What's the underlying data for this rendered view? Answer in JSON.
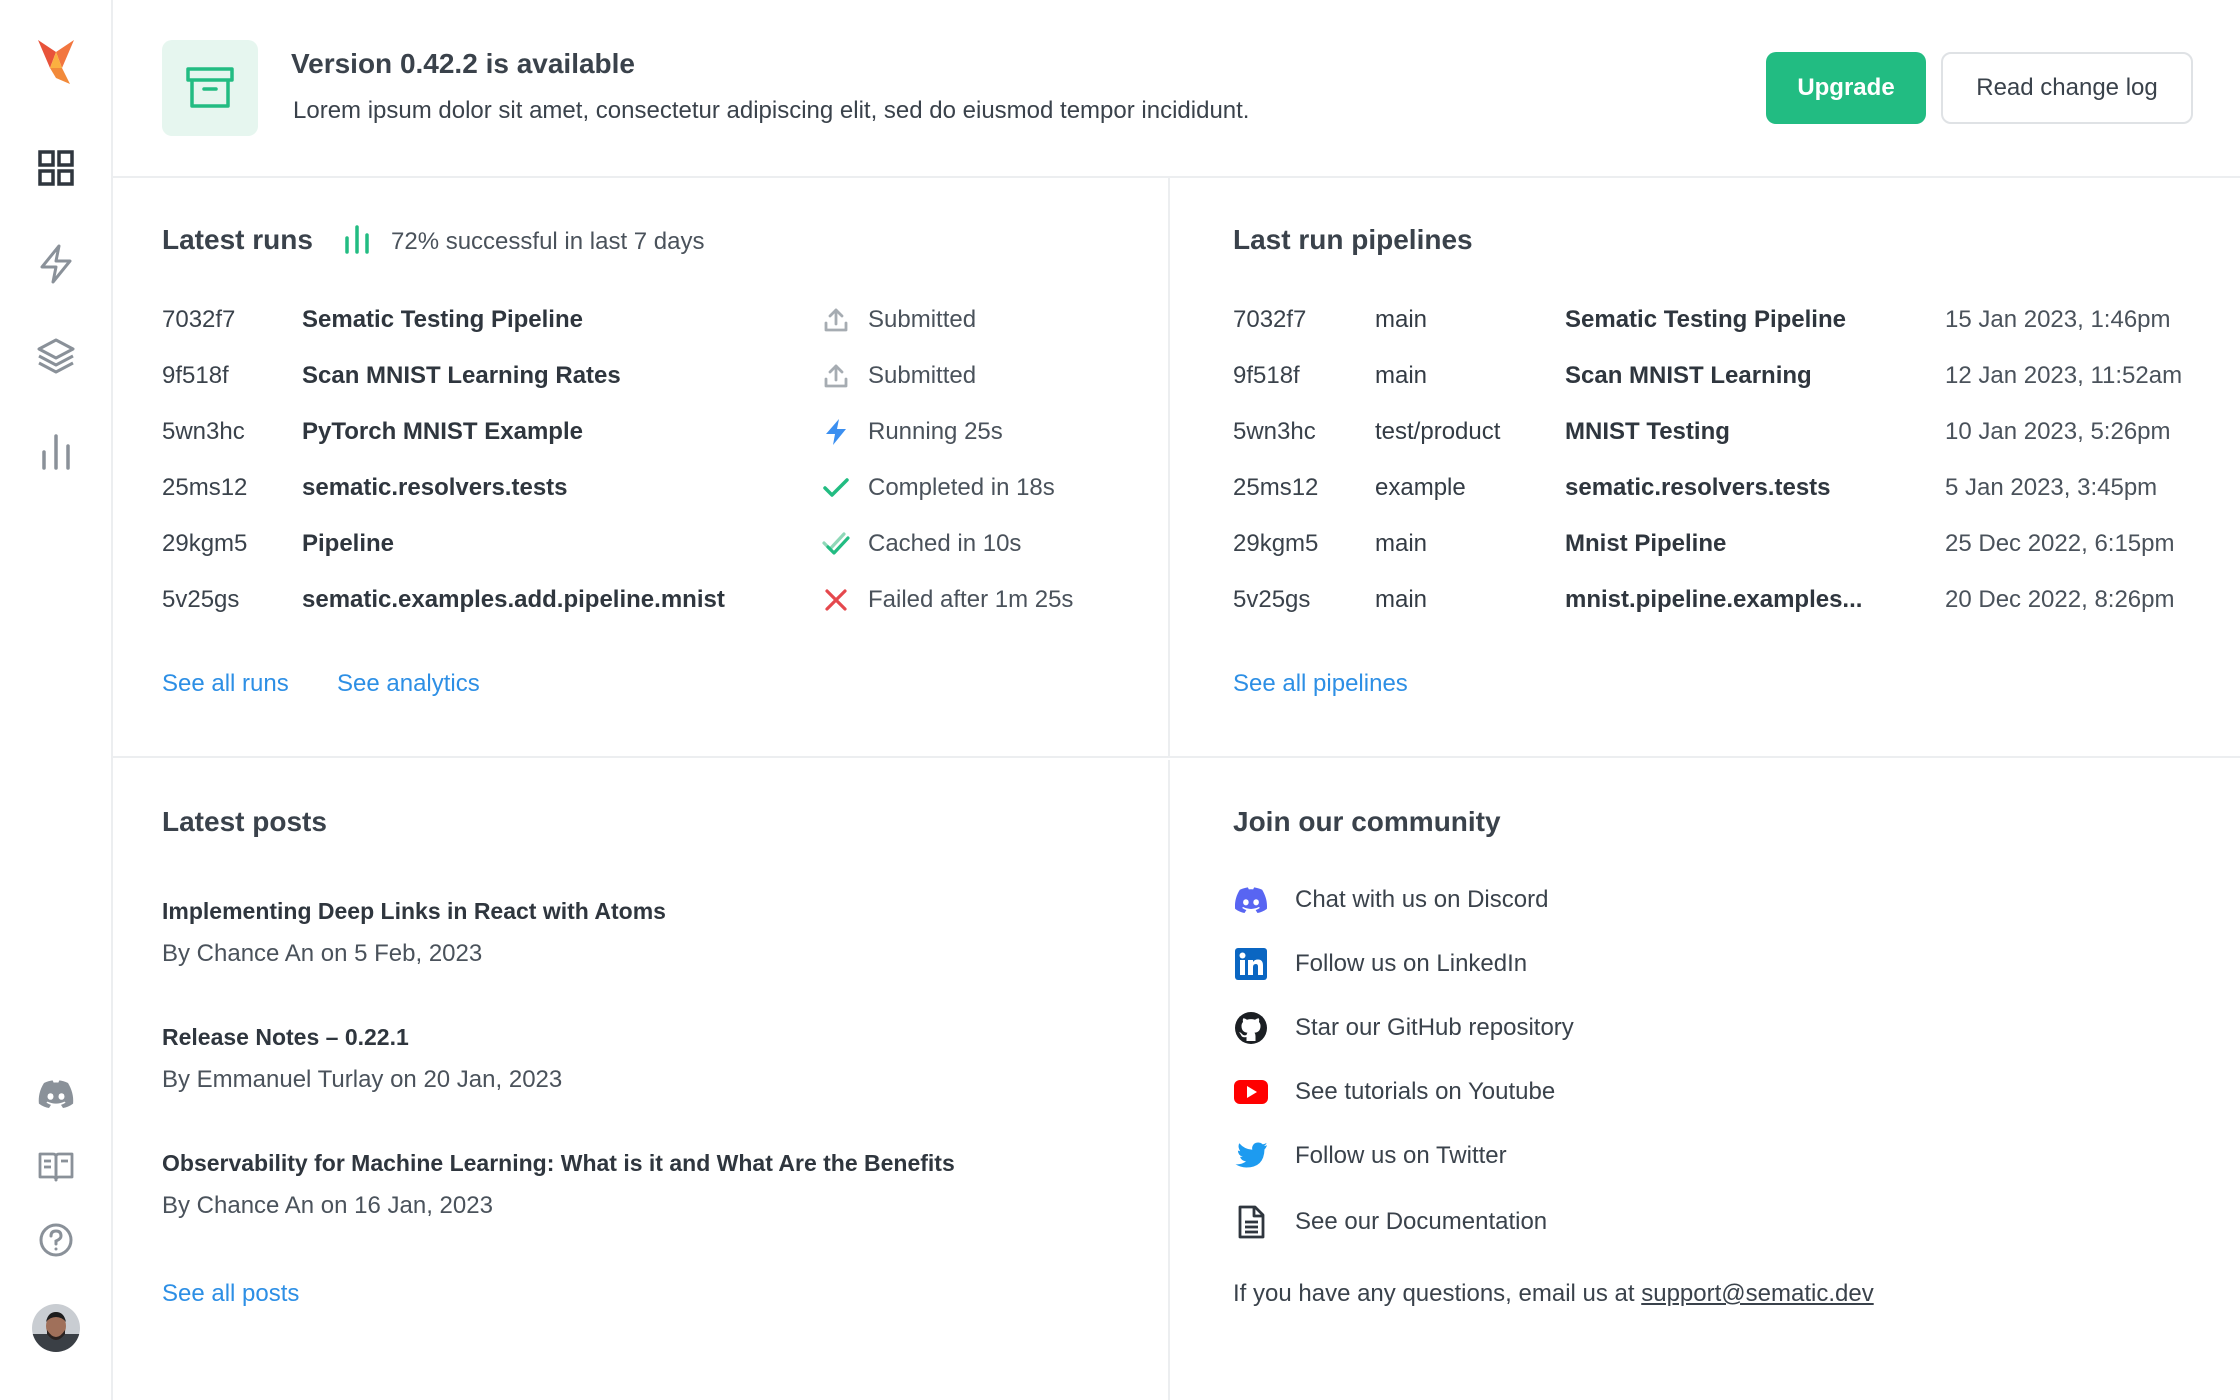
{
  "banner": {
    "title": "Version 0.42.2 is available",
    "description": "Lorem ipsum dolor sit amet, consectetur adipiscing elit, sed do eiusmod tempor incididunt.",
    "upgrade_label": "Upgrade",
    "changelog_label": "Read change log",
    "icon": "archive-box-icon"
  },
  "sidebar": {
    "icons": [
      "logo-icon",
      "dashboard-grid-icon",
      "lightning-icon",
      "layers-icon",
      "bar-chart-icon",
      "discord-icon",
      "book-icon",
      "help-circle-icon",
      "avatar"
    ]
  },
  "latest_runs": {
    "title": "Latest runs",
    "success_text": "72% successful in last 7 days",
    "runs": [
      {
        "id": "7032f7",
        "name": "Sematic Testing Pipeline",
        "status": "Submitted",
        "status_icon": "upload-icon"
      },
      {
        "id": "9f518f",
        "name": "Scan MNIST Learning Rates",
        "status": "Submitted",
        "status_icon": "upload-icon"
      },
      {
        "id": "5wn3hc",
        "name": "PyTorch MNIST Example",
        "status": "Running 25s",
        "status_icon": "lightning-icon"
      },
      {
        "id": "25ms12",
        "name": "sematic.resolvers.tests",
        "status": "Completed in 18s",
        "status_icon": "check-icon"
      },
      {
        "id": "29kgm5",
        "name": "Pipeline",
        "status": "Cached in 10s",
        "status_icon": "double-check-icon"
      },
      {
        "id": "5v25gs",
        "name": "sematic.examples.add.pipeline.mnist",
        "status": "Failed after 1m 25s",
        "status_icon": "x-icon"
      }
    ],
    "see_all_label": "See all runs",
    "see_analytics_label": "See analytics"
  },
  "last_pipelines": {
    "title": "Last run pipelines",
    "pipelines": [
      {
        "id": "7032f7",
        "branch": "main",
        "name": "Sematic Testing Pipeline",
        "date": "15 Jan 2023, 1:46pm"
      },
      {
        "id": "9f518f",
        "branch": "main",
        "name": "Scan MNIST Learning",
        "date": "12 Jan 2023, 11:52am"
      },
      {
        "id": "5wn3hc",
        "branch": "test/product",
        "name": "MNIST Testing",
        "date": "10 Jan 2023, 5:26pm"
      },
      {
        "id": "25ms12",
        "branch": "example",
        "name": "sematic.resolvers.tests",
        "date": "5 Jan 2023, 3:45pm"
      },
      {
        "id": "29kgm5",
        "branch": "main",
        "name": "Mnist Pipeline",
        "date": "25 Dec 2022, 6:15pm"
      },
      {
        "id": "5v25gs",
        "branch": "main",
        "name": "mnist.pipeline.examples...",
        "date": "20 Dec 2022, 8:26pm"
      }
    ],
    "see_all_label": "See all pipelines"
  },
  "latest_posts": {
    "title": "Latest posts",
    "posts": [
      {
        "title": "Implementing Deep Links in React with Atoms",
        "meta": "By Chance An on 5 Feb, 2023"
      },
      {
        "title": "Release Notes – 0.22.1",
        "meta": "By Emmanuel Turlay on 20 Jan, 2023"
      },
      {
        "title": "Observability for Machine Learning: What is it and What Are the Benefits",
        "meta": "By Chance An on 16 Jan, 2023"
      }
    ],
    "see_all_label": "See all posts"
  },
  "community": {
    "title": "Join our community",
    "items": [
      {
        "label": "Chat with us on Discord",
        "icon": "discord-icon"
      },
      {
        "label": "Follow us on LinkedIn",
        "icon": "linkedin-icon"
      },
      {
        "label": "Star our GitHub repository",
        "icon": "github-icon"
      },
      {
        "label": "See tutorials on Youtube",
        "icon": "youtube-icon"
      },
      {
        "label": "Follow us on Twitter",
        "icon": "twitter-icon"
      },
      {
        "label": "See our Documentation",
        "icon": "document-icon"
      }
    ],
    "email_prefix": "If you have any questions, email us at ",
    "email": "support@sematic.dev"
  },
  "colors": {
    "accent_green": "#22bc82",
    "link_blue": "#2d8fe5",
    "fail_red": "#e5484d",
    "running_blue": "#3b8ff0"
  }
}
